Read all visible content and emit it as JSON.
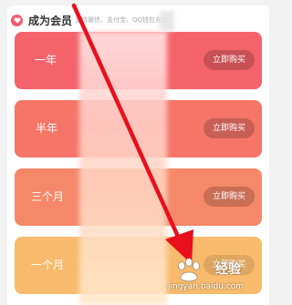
{
  "header": {
    "title": "成为会员",
    "subtitle": "支持微信、支付宝、QQ钱包充值",
    "icon": "heart-icon"
  },
  "plans": [
    {
      "name": "一年",
      "buy_label": "立即购买",
      "color": "#f5636a"
    },
    {
      "name": "半年",
      "buy_label": "立即购买",
      "color": "#f57568"
    },
    {
      "name": "三个月",
      "buy_label": "立即购买",
      "color": "#f58868"
    },
    {
      "name": "一个月",
      "buy_label": "立即购买",
      "color": "#f8ba6c"
    }
  ],
  "annotation": {
    "arrow_color": "#e8101c"
  },
  "watermark": {
    "main": "经验",
    "url": "jingyan.baidu.com",
    "icon": "baidu-paw-icon"
  }
}
